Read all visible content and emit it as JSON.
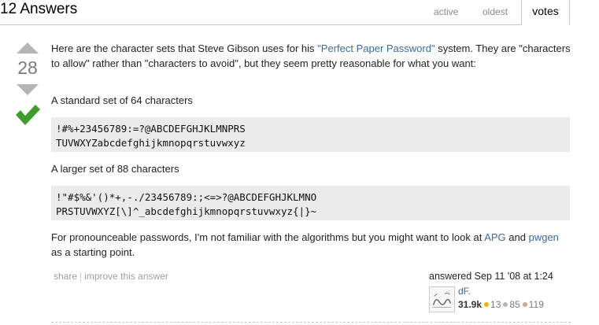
{
  "header": {
    "title": "12 Answers"
  },
  "tabs": [
    {
      "label": "active"
    },
    {
      "label": "oldest"
    },
    {
      "label": "votes"
    }
  ],
  "vote": {
    "count": "28",
    "accepted": true
  },
  "answer": {
    "p1_text": "Here are the character sets that Steve Gibson uses for his ",
    "p1_link": "\"Perfect Paper Password\"",
    "p1_rest": " system. They are \"characters to allow\" rather than \"characters to avoid\", but they seem pretty reasonable for what you want:",
    "p2": "A standard set of 64 characters",
    "code1": "!#%+23456789:=?@ABCDEFGHJKLMNPRS\nTUVWXYZabcdefghijkmnopqrstuvwxyz",
    "p3": "A larger set of 88 characters",
    "code2": "!\"#$%&'()*+,-./23456789:;<=>?@ABCDEFGHJKLMNO\nPRSTUVWXYZ[\\]^_abcdefghijkmnopqrstuvwxyz{|}~",
    "p4_a": "For pronounceable passwords, I'm not familiar with the algorithms but you might want to look at ",
    "p4_link1": "APG",
    "p4_b": " and ",
    "p4_link2": "pwgen",
    "p4_c": " as a starting point."
  },
  "post_menu": {
    "share": "share",
    "sep": "|",
    "improve": "improve this answer"
  },
  "signature": {
    "action": "answered Sep 11 '08 at 1:24",
    "user": "dF.",
    "reputation": "31.9k",
    "gold": "13",
    "silver": "85",
    "bronze": "119",
    "gold_color": "#f1b600",
    "silver_color": "#b4b8bc",
    "bronze_color": "#d1a684"
  }
}
